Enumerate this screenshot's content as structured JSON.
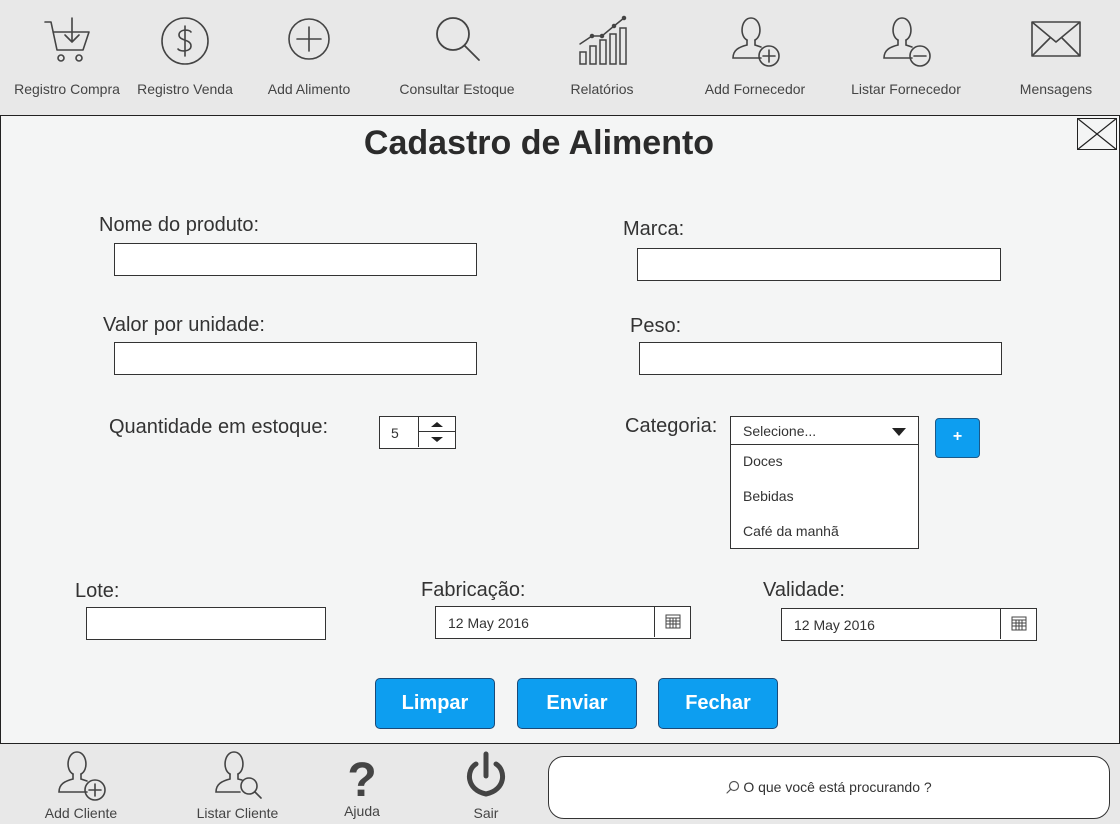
{
  "toolbar": {
    "items": [
      {
        "label": "Registro Compra",
        "icon": "cart-download-icon"
      },
      {
        "label": "Registro Venda",
        "icon": "dollar-icon"
      },
      {
        "label": "Add Alimento",
        "icon": "plus-circle-icon"
      },
      {
        "label": "Consultar Estoque",
        "icon": "search-icon"
      },
      {
        "label": "Relatórios",
        "icon": "chart-icon"
      },
      {
        "label": "Add Fornecedor",
        "icon": "user-add-icon"
      },
      {
        "label": "Listar Fornecedor",
        "icon": "user-remove-icon"
      },
      {
        "label": "Mensagens",
        "icon": "envelope-icon"
      }
    ]
  },
  "form": {
    "title": "Cadastro de Alimento",
    "nome_label": "Nome do produto:",
    "nome_value": "",
    "marca_label": "Marca:",
    "marca_value": "",
    "valor_label": "Valor por unidade:",
    "valor_value": "",
    "peso_label": "Peso:",
    "peso_value": "",
    "quantidade_label": "Quantidade em estoque:",
    "quantidade_value": "5",
    "categoria_label": "Categoria:",
    "categoria_selected": "Selecione...",
    "categoria_options": [
      "Doces",
      "Bebidas",
      "Café da manhã"
    ],
    "add_categoria_label": "+",
    "lote_label": "Lote:",
    "lote_value": "",
    "fabricacao_label": "Fabricação:",
    "fabricacao_value": "12 May 2016",
    "validade_label": "Validade:",
    "validade_value": "12 May 2016"
  },
  "actions": {
    "limpar": "Limpar",
    "enviar": "Enviar",
    "fechar": "Fechar"
  },
  "bottombar": {
    "items": [
      {
        "label": "Add Cliente",
        "icon": "user-add-icon"
      },
      {
        "label": "Listar Cliente",
        "icon": "user-search-icon"
      },
      {
        "label": "Ajuda",
        "icon": "question-icon"
      },
      {
        "label": "Sair",
        "icon": "power-icon"
      }
    ],
    "search_placeholder": "O que você está procurando ?"
  },
  "colors": {
    "accent": "#0d9ef0",
    "background": "#ececec",
    "panel": "#f4f5f5"
  }
}
